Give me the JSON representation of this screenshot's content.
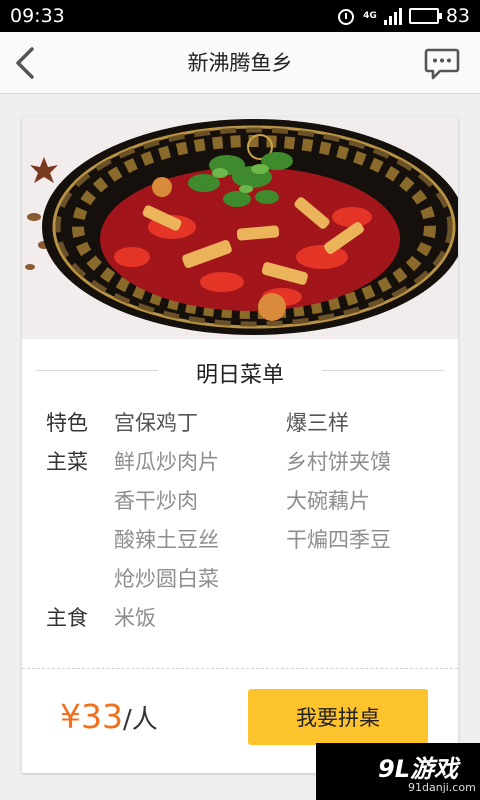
{
  "status_bar": {
    "time": "09:33",
    "network": "4G",
    "battery": "83",
    "icons": [
      "alarm-icon",
      "signal-icon",
      "battery-icon"
    ]
  },
  "header": {
    "title": "新沸腾鱼乡",
    "back_icon": "chevron-left-icon",
    "chat_icon": "chat-bubble-icon"
  },
  "menu": {
    "title": "明日菜单",
    "specialty_label": "特色",
    "specialty": [
      "宫保鸡丁",
      "爆三样"
    ],
    "main_label": "主菜",
    "main_dishes": [
      "鲜瓜炒肉片",
      "乡村饼夹馍",
      "香干炒肉",
      "大碗藕片",
      "酸辣土豆丝",
      "干煸四季豆",
      "炝炒圆白菜"
    ],
    "staple_label": "主食",
    "staple": [
      "米饭"
    ]
  },
  "footer": {
    "price": "¥33",
    "price_unit": "/人",
    "join_button": "我要拼桌"
  },
  "watermark": {
    "logo": "9L游戏",
    "url": "91danji.com"
  },
  "colors": {
    "accent_button": "#fdc32c",
    "price": "#f0701e",
    "status_bar": "#000000"
  }
}
